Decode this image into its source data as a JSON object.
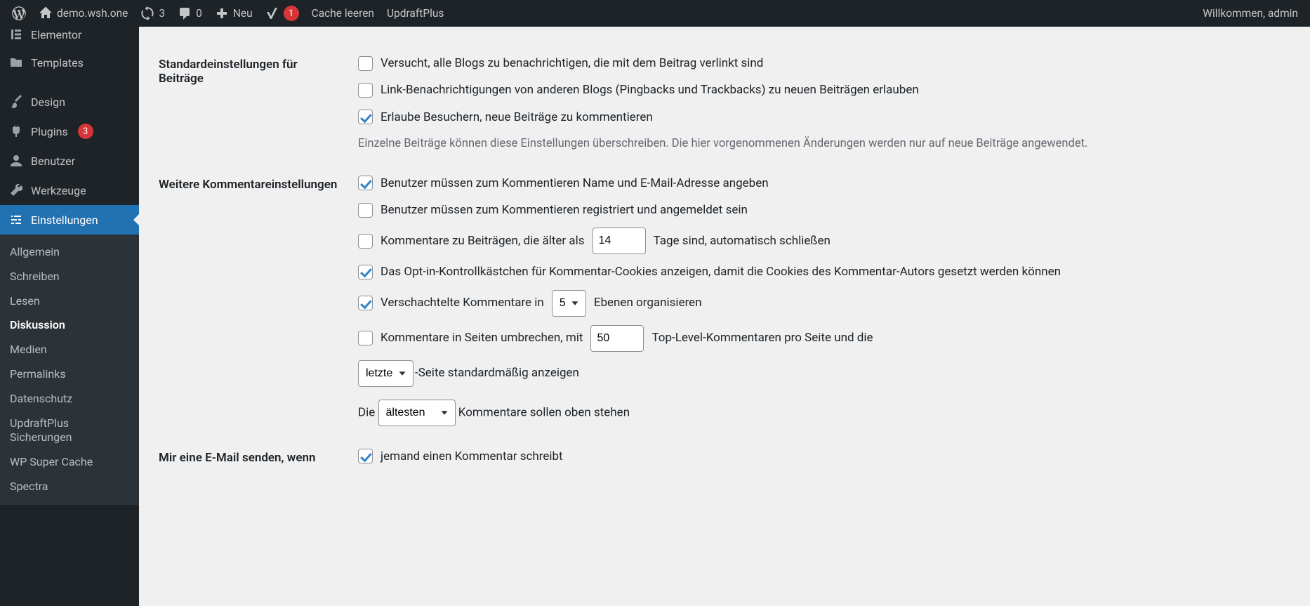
{
  "adminbar": {
    "site_name": "demo.wsh.one",
    "updates": "3",
    "comments": "0",
    "new": "Neu",
    "yoast_badge": "1",
    "cache": "Cache leeren",
    "updraft": "UpdraftPlus",
    "welcome": "Willkommen, admin"
  },
  "sidebar": {
    "items": [
      {
        "label": "Elementor",
        "icon": "elementor"
      },
      {
        "label": "Templates",
        "icon": "templates"
      },
      {
        "label": "Design",
        "icon": "brush"
      },
      {
        "label": "Plugins",
        "icon": "plugin",
        "count": "3"
      },
      {
        "label": "Benutzer",
        "icon": "user"
      },
      {
        "label": "Werkzeuge",
        "icon": "wrench"
      },
      {
        "label": "Einstellungen",
        "icon": "sliders"
      }
    ],
    "submenu": [
      "Allgemein",
      "Schreiben",
      "Lesen",
      "Diskussion",
      "Medien",
      "Permalinks",
      "Datenschutz",
      "UpdraftPlus Sicherungen",
      "WP Super Cache",
      "Spectra"
    ],
    "submenu_current": "Diskussion"
  },
  "settings": {
    "section1_title": "Standardeinstellungen für Beiträge",
    "s1_cb1": "Versucht, alle Blogs zu benachrichtigen, die mit dem Beitrag verlinkt sind",
    "s1_cb2": "Link-Benachrichtigungen von anderen Blogs (Pingbacks und Trackbacks) zu neuen Beiträgen erlauben",
    "s1_cb3": "Erlaube Besuchern, neue Beiträge zu kommentieren",
    "s1_desc": "Einzelne Beiträge können diese Einstellungen überschreiben. Die hier vorgenommenen Änderungen werden nur auf neue Beiträge angewendet.",
    "section2_title": "Weitere Kommentareinstellungen",
    "s2_cb1": "Benutzer müssen zum Kommentieren Name und E-Mail-Adresse angeben",
    "s2_cb2": "Benutzer müssen zum Kommentieren registriert und angemeldet sein",
    "s2_cb3_before": "Kommentare zu Beiträgen, die älter als",
    "s2_cb3_days": "14",
    "s2_cb3_after": "Tage sind, automatisch schließen",
    "s2_cb4": "Das Opt-in-Kontrollkästchen für Kommentar-Cookies anzeigen, damit die Cookies des Kommentar-Autors gesetzt werden können",
    "s2_cb5_before": "Verschachtelte Kommentare in",
    "s2_cb5_level": "5",
    "s2_cb5_after": "Ebenen organisieren",
    "s2_cb6_before": "Kommentare in Seiten umbrechen, mit",
    "s2_cb6_count": "50",
    "s2_cb6_after": "Top-Level-Kommentaren pro Seite und die",
    "s2_page_sel": "letzte",
    "s2_page_after": "-Seite standardmäßig anzeigen",
    "s2_order_before": "Die",
    "s2_order_sel": "ältesten",
    "s2_order_after": "Kommentare sollen oben stehen",
    "section3_title": "Mir eine E-Mail senden, wenn",
    "s3_cb1": "jemand einen Kommentar schreibt"
  }
}
